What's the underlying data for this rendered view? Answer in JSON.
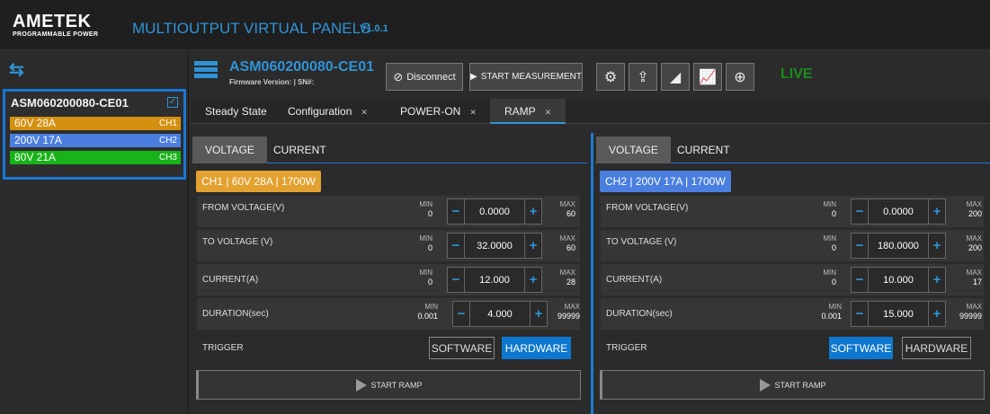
{
  "header": {
    "logo_name": "AMETEK",
    "logo_sub": "PROGRAMMABLE POWER",
    "title": "MULTIOUTPUT VIRTUAL PANELS",
    "version": "V1.0.1"
  },
  "sidebar": {
    "device": "ASM060200080-CE01",
    "channels": [
      {
        "label": "60V 28A",
        "tag": "CH1",
        "color": "#d4900f"
      },
      {
        "label": "200V 17A",
        "tag": "CH2",
        "color": "#4a7fe0"
      },
      {
        "label": "80V 21A",
        "tag": "CH3",
        "color": "#18b318"
      }
    ]
  },
  "device": {
    "title": "ASM060200080-CE01",
    "firmware": "Firmware Version: | SN#:",
    "disconnect_label": "Disconnect",
    "start_measurement_label": "START MEASUREMENT",
    "live": "LIVE",
    "icons": [
      "gear-icon",
      "export-icon",
      "ramp-icon",
      "chart-icon",
      "target-icon"
    ]
  },
  "tabs": [
    {
      "label": "Steady State",
      "closable": false
    },
    {
      "label": "Configuration",
      "closable": true
    },
    {
      "label": "POWER-ON",
      "closable": true
    },
    {
      "label": "RAMP",
      "closable": true
    }
  ],
  "panels": [
    {
      "subtab_voltage": "VOLTAGE",
      "subtab_current": "CURRENT",
      "channel_label": "CH1 | 60V 28A | 1700W",
      "channel_color": "#e3a12f",
      "rows": [
        {
          "label": "FROM VOLTAGE(V)",
          "min_label": "MIN",
          "min": "0",
          "value": "0.0000",
          "max_label": "MAX",
          "max": "60"
        },
        {
          "label": "TO VOLTAGE (V)",
          "min_label": "MIN",
          "min": "0",
          "value": "32.0000",
          "max_label": "MAX",
          "max": "60"
        },
        {
          "label": "CURRENT(A)",
          "min_label": "MIN",
          "min": "0",
          "value": "12.000",
          "max_label": "MAX",
          "max": "28"
        },
        {
          "label": "DURATION(sec)",
          "min_label": "MIN",
          "min": "0.001",
          "value": "4.000",
          "max_label": "MAX",
          "max": "99999"
        }
      ],
      "trigger_label": "TRIGGER",
      "software": "SOFTWARE",
      "hardware": "HARDWARE",
      "trigger_selected": "HARDWARE",
      "start_ramp": "START RAMP"
    },
    {
      "subtab_voltage": "VOLTAGE",
      "subtab_current": "CURRENT",
      "channel_label": "CH2 | 200V 17A | 1700W",
      "channel_color": "#4a7fe0",
      "rows": [
        {
          "label": "FROM VOLTAGE(V)",
          "min_label": "MIN",
          "min": "0",
          "value": "0.0000",
          "max_label": "MAX",
          "max": "200"
        },
        {
          "label": "TO VOLTAGE (V)",
          "min_label": "MIN",
          "min": "0",
          "value": "180.0000",
          "max_label": "MAX",
          "max": "200"
        },
        {
          "label": "CURRENT(A)",
          "min_label": "MIN",
          "min": "0",
          "value": "10.000",
          "max_label": "MAX",
          "max": "17"
        },
        {
          "label": "DURATION(sec)",
          "min_label": "MIN",
          "min": "0.001",
          "value": "15.000",
          "max_label": "MAX",
          "max": "99999"
        }
      ],
      "trigger_label": "TRIGGER",
      "software": "SOFTWARE",
      "hardware": "HARDWARE",
      "trigger_selected": "SOFTWARE",
      "start_ramp": "START RAMP"
    }
  ]
}
